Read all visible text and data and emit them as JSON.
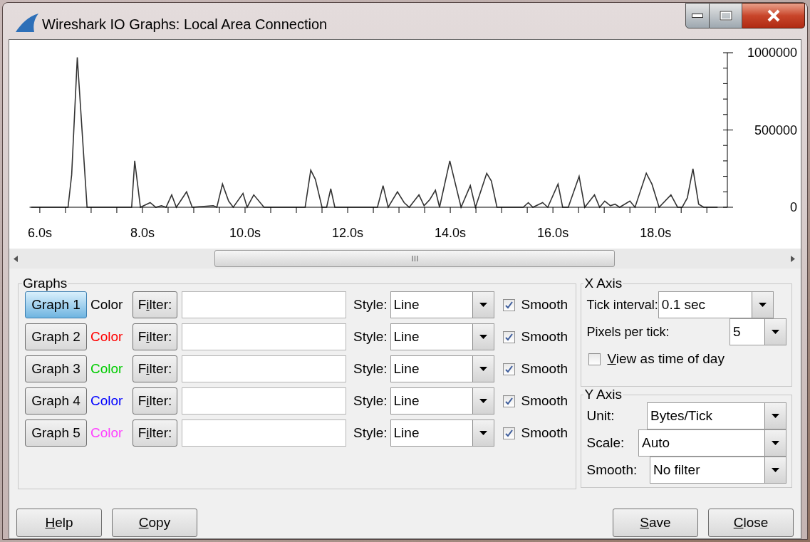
{
  "window": {
    "title": "Wireshark IO Graphs: Local Area Connection"
  },
  "chart": {
    "chart_data": {
      "type": "line",
      "xlim": [
        5.8,
        19.4
      ],
      "ylim": [
        0,
        1000000
      ],
      "xticks": [
        {
          "value": 6,
          "label": "6.0s"
        },
        {
          "value": 8,
          "label": "8.0s"
        },
        {
          "value": 10,
          "label": "10.0s"
        },
        {
          "value": 12,
          "label": "12.0s"
        },
        {
          "value": 14,
          "label": "14.0s"
        },
        {
          "value": 16,
          "label": "16.0s"
        },
        {
          "value": 18,
          "label": "18.0s"
        }
      ],
      "yticks": [
        0,
        500000,
        1000000
      ],
      "x": [
        5.83,
        6.55,
        6.62,
        6.73,
        6.92,
        7.79,
        7.85,
        7.96,
        8.15,
        8.26,
        8.37,
        8.46,
        8.57,
        8.66,
        8.86,
        8.97,
        9.38,
        9.45,
        9.56,
        9.68,
        9.77,
        9.96,
        10.04,
        10.17,
        10.37,
        11.17,
        11.28,
        11.37,
        11.5,
        11.59,
        11.67,
        11.75,
        12.58,
        12.69,
        12.79,
        12.97,
        13.1,
        13.2,
        13.39,
        13.49,
        13.6,
        13.71,
        13.79,
        13.99,
        14.21,
        14.39,
        14.49,
        14.71,
        14.8,
        14.91,
        15.42,
        15.52,
        15.61,
        15.8,
        15.9,
        16.1,
        16.19,
        16.3,
        16.51,
        16.62,
        16.81,
        16.91,
        17.01,
        17.12,
        17.21,
        17.3,
        17.5,
        17.6,
        17.82,
        17.93,
        18.07,
        18.3,
        18.43,
        18.52,
        18.62,
        18.73,
        18.84,
        18.94,
        19.21
      ],
      "series": [
        {
          "color": "#000000",
          "values": [
            0,
            0,
            210000,
            970000,
            0,
            0,
            300000,
            0,
            30000,
            0,
            10000,
            0,
            80000,
            0,
            100000,
            0,
            10000,
            0,
            150000,
            40000,
            0,
            90000,
            0,
            80000,
            0,
            0,
            240000,
            180000,
            0,
            0,
            120000,
            0,
            0,
            140000,
            0,
            100000,
            30000,
            0,
            80000,
            10000,
            50000,
            110000,
            0,
            300000,
            0,
            140000,
            0,
            220000,
            170000,
            0,
            0,
            30000,
            0,
            30000,
            0,
            150000,
            0,
            0,
            200000,
            0,
            80000,
            0,
            40000,
            10000,
            20000,
            0,
            40000,
            0,
            220000,
            150000,
            0,
            80000,
            0,
            0,
            60000,
            250000,
            20000,
            0,
            0
          ]
        }
      ]
    }
  },
  "graphs_panel": {
    "title": "Graphs",
    "rows": [
      {
        "button": "Graph 1",
        "selected": true,
        "color_label": "Color",
        "color": "#000000",
        "filter_button": {
          "pre": "F",
          "key": "i",
          "post": "lter:"
        },
        "style_label": "Style:",
        "style": "Line",
        "smooth_label": "Smooth",
        "smooth": true
      },
      {
        "button": "Graph 2",
        "selected": false,
        "color_label": "Color",
        "color": "#ff0000",
        "filter_button": {
          "pre": "F",
          "key": "i",
          "post": "lter:"
        },
        "style_label": "Style:",
        "style": "Line",
        "smooth_label": "Smooth",
        "smooth": true
      },
      {
        "button": "Graph 3",
        "selected": false,
        "color_label": "Color",
        "color": "#00cc00",
        "filter_button": {
          "pre": "F",
          "key": "i",
          "post": "lter:"
        },
        "style_label": "Style:",
        "style": "Line",
        "smooth_label": "Smooth",
        "smooth": true
      },
      {
        "button": "Graph 4",
        "selected": false,
        "color_label": "Color",
        "color": "#0000ff",
        "filter_button": {
          "pre": "F",
          "key": "i",
          "post": "lter:"
        },
        "style_label": "Style:",
        "style": "Line",
        "smooth_label": "Smooth",
        "smooth": true
      },
      {
        "button": "Graph 5",
        "selected": false,
        "color_label": "Color",
        "color": "#ff40ff",
        "filter_button": {
          "pre": "F",
          "key": "i",
          "post": "lter:"
        },
        "style_label": "Style:",
        "style": "Line",
        "smooth_label": "Smooth",
        "smooth": true
      }
    ]
  },
  "x_axis": {
    "title": "X Axis",
    "tick_interval": {
      "label": "Tick interval:",
      "value": "0.1 sec"
    },
    "pixels_per_tick": {
      "label": "Pixels per tick:",
      "value": "5"
    },
    "time_of_day": {
      "label": {
        "key": "V",
        "post": "iew as time of day"
      },
      "checked": false
    }
  },
  "y_axis": {
    "title": "Y Axis",
    "unit": {
      "label": "Unit:",
      "value": "Bytes/Tick"
    },
    "scale": {
      "label": "Scale:",
      "value": "Auto"
    },
    "smooth": {
      "label": "Smooth:",
      "value": "No filter"
    }
  },
  "left_buttons": [
    {
      "label": {
        "key": "H",
        "post": "elp"
      }
    },
    {
      "label": {
        "key": "C",
        "post": "opy"
      }
    }
  ],
  "right_buttons": [
    {
      "label": {
        "key": "S",
        "post": "ave"
      }
    },
    {
      "label": {
        "key": "C",
        "post": "lose"
      }
    }
  ]
}
